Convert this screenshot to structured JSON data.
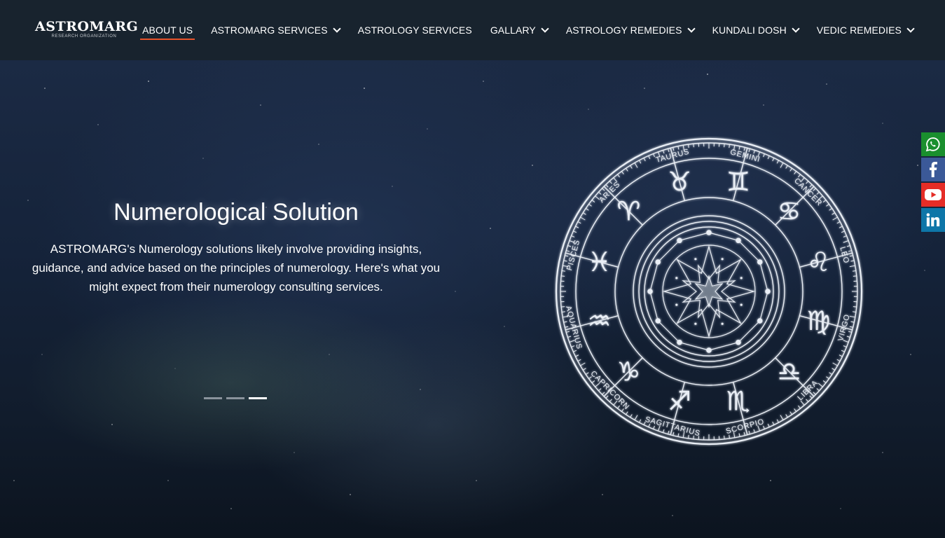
{
  "brand": {
    "name": "ASTROMARG",
    "tagline": "RESEARCH ORGANIZATION"
  },
  "nav": {
    "items": [
      {
        "label": "ABOUT US",
        "active": true,
        "dropdown": false
      },
      {
        "label": "ASTROMARG SERVICES",
        "active": false,
        "dropdown": true
      },
      {
        "label": "ASTROLOGY SERVICES",
        "active": false,
        "dropdown": false
      },
      {
        "label": "GALLARY",
        "active": false,
        "dropdown": true
      },
      {
        "label": "ASTROLOGY REMEDIES",
        "active": false,
        "dropdown": true
      },
      {
        "label": "KUNDALI DOSH",
        "active": false,
        "dropdown": true
      },
      {
        "label": "VEDIC REMEDIES",
        "active": false,
        "dropdown": true
      }
    ]
  },
  "hero": {
    "title": "Numerological Solution",
    "description": "ASTROMARG's Numerology solutions likely involve providing insights, guidance, and advice based on the principles of numerology. Here's what you might expect from their numerology consulting services.",
    "slides_total": 3,
    "active_slide": 3
  },
  "zodiac": {
    "signs": [
      "TAURUS",
      "GEMINI",
      "CANCER",
      "LEO",
      "VIRGO",
      "LIBRA",
      "SCORPIO",
      "SAGITTARIUS",
      "CAPRICORN",
      "AQUARIUS",
      "PISCES",
      "ARIES"
    ],
    "glyphs": [
      "♉",
      "♊",
      "♋",
      "♌",
      "♍",
      "♎",
      "♏",
      "♐",
      "♑",
      "♒",
      "♓",
      "♈"
    ]
  },
  "social": {
    "items": [
      {
        "name": "whatsapp-icon",
        "color": "#1a8f2e"
      },
      {
        "name": "facebook-icon",
        "color": "#3b5998"
      },
      {
        "name": "youtube-icon",
        "color": "#e52d27"
      },
      {
        "name": "linkedin-icon",
        "color": "#0e76a8"
      }
    ]
  },
  "colors": {
    "header_bg": "#18232e",
    "active_underline": "#e8532a"
  }
}
